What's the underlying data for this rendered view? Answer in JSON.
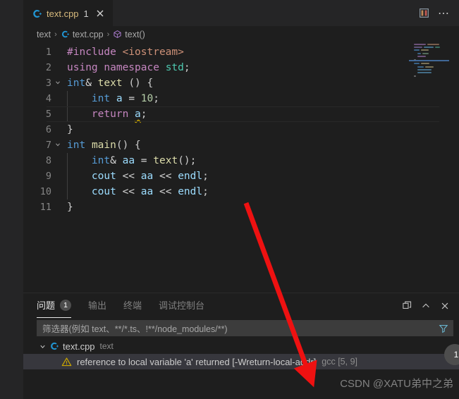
{
  "window": {
    "background": "#1e1e1e",
    "sidebar_background": "#252526"
  },
  "tabbar": {
    "tab": {
      "icon": "cpp-file-icon",
      "label": "text.cpp",
      "problem_count": "1",
      "close_icon": "close-icon"
    },
    "actions": [
      {
        "icon": "split-editor-icon",
        "name": "split-editor-button"
      },
      {
        "icon": "more-actions-icon",
        "name": "more-actions-button",
        "glyph": "⋯"
      }
    ]
  },
  "breadcrumbs": {
    "items": [
      {
        "label": "text",
        "icon": null
      },
      {
        "label": "text.cpp",
        "icon": "cpp-file-icon"
      },
      {
        "label": "text()",
        "icon": "symbol-method-icon"
      }
    ],
    "separator": "›"
  },
  "editor": {
    "language": "cpp",
    "lines": [
      {
        "num": "1",
        "fold": "",
        "html": "<span class=\"t-pre\">#include</span> <span class=\"t-inc\">&lt;iostream&gt;</span>"
      },
      {
        "num": "2",
        "fold": "",
        "html": "<span class=\"t-kw\">using</span> <span class=\"t-kw\">namespace</span> <span class=\"t-type\">std</span><span class=\"t-punc\">;</span>"
      },
      {
        "num": "3",
        "fold": "chevron-down",
        "html": "<span class=\"t-blue\">int</span><span class=\"t-op\">&amp;</span> <span class=\"t-fn\">text</span> <span class=\"t-punc\">() {</span>"
      },
      {
        "num": "4",
        "fold": "",
        "html": "    <span class=\"t-blue\">int</span> <span class=\"t-var\">a</span> <span class=\"t-op\">=</span> <span class=\"t-num\">10</span><span class=\"t-punc\">;</span>"
      },
      {
        "num": "5",
        "fold": "",
        "highlight": true,
        "html": "    <span class=\"t-kw\">return</span> <span class=\"t-var squiggle\">a</span><span class=\"t-punc\">;</span>"
      },
      {
        "num": "6",
        "fold": "",
        "html": "<span class=\"t-punc\">}</span>"
      },
      {
        "num": "7",
        "fold": "chevron-down",
        "html": "<span class=\"t-blue\">int</span> <span class=\"t-fn\">main</span><span class=\"t-punc\">() {</span>"
      },
      {
        "num": "8",
        "fold": "",
        "html": "    <span class=\"t-blue\">int</span><span class=\"t-op\">&amp;</span> <span class=\"t-var\">aa</span> <span class=\"t-op\">=</span> <span class=\"t-fn\">text</span><span class=\"t-punc\">();</span>"
      },
      {
        "num": "9",
        "fold": "",
        "html": "    <span class=\"t-var\">cout</span> <span class=\"t-op\">&lt;&lt;</span> <span class=\"t-var\">aa</span> <span class=\"t-op\">&lt;&lt;</span> <span class=\"t-var\">endl</span><span class=\"t-punc\">;</span>"
      },
      {
        "num": "10",
        "fold": "",
        "html": "    <span class=\"t-var\">cout</span> <span class=\"t-op\">&lt;&lt;</span> <span class=\"t-var\">aa</span> <span class=\"t-op\">&lt;&lt;</span> <span class=\"t-var\">endl</span><span class=\"t-punc\">;</span>"
      },
      {
        "num": "11",
        "fold": "",
        "html": "<span class=\"t-punc\">}</span>"
      }
    ],
    "minimap": {
      "name": "minimap",
      "slider_color": "#4a7ebb"
    }
  },
  "panel": {
    "tabs": [
      {
        "label": "问题",
        "badge": "1",
        "active": true
      },
      {
        "label": "输出",
        "badge": null,
        "active": false
      },
      {
        "label": "终端",
        "badge": null,
        "active": false
      },
      {
        "label": "调试控制台",
        "badge": null,
        "active": false
      }
    ],
    "actions": [
      {
        "icon": "maximize-panel-icon",
        "name": "maximize-panel-button"
      },
      {
        "icon": "chevron-up-icon",
        "name": "collapse-panel-button",
        "glyph": "⌃"
      },
      {
        "icon": "close-icon",
        "name": "close-panel-button",
        "glyph": "✕"
      }
    ],
    "filter": {
      "placeholder": "筛选器(例如 text、**/*.ts、!**/node_modules/**)",
      "value": "",
      "funnel_icon": "filter-funnel-icon"
    },
    "badge_corner": "1",
    "problems": [
      {
        "twisty": "chevron-down",
        "icon": "cpp-file-icon",
        "file": "text.cpp",
        "folder": "text",
        "children": [
          {
            "severity": "warning",
            "icon": "warning-icon",
            "message": "reference to local variable 'a' returned [-Wreturn-local-addr]",
            "source": "gcc [5, 9]"
          }
        ]
      }
    ]
  },
  "annotations": {
    "arrow": {
      "color": "#ee1111",
      "name": "red-annotation-arrow"
    },
    "watermark": "CSDN @XATU弟中之弟"
  }
}
